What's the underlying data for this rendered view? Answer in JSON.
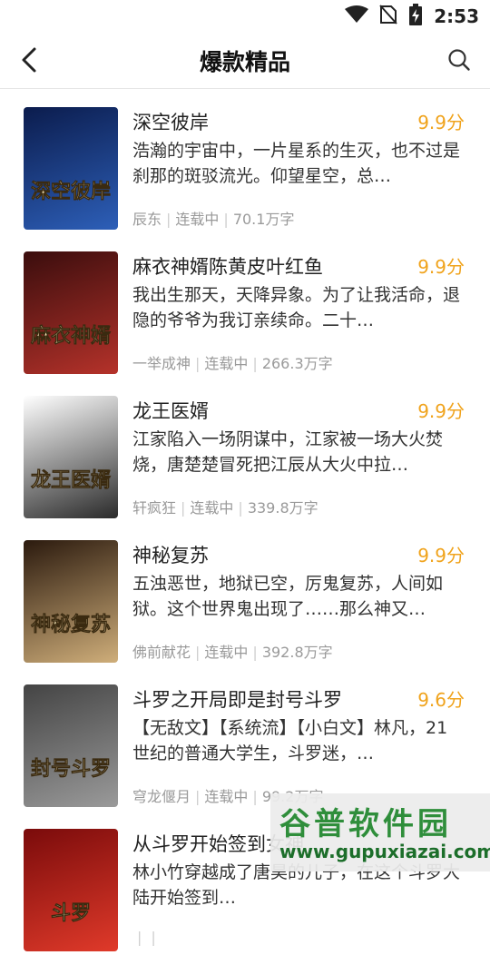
{
  "status_bar": {
    "time": "2:53"
  },
  "header": {
    "title": "爆款精品"
  },
  "books": [
    {
      "title": "深空彼岸",
      "score": "9.9分",
      "desc": "浩瀚的宇宙中，一片星系的生灭，也不过是刹那的斑驳流光。仰望星空，总…",
      "author": "辰东",
      "status": "连载中",
      "words": "70.1万字",
      "cover_text": "深空彼岸",
      "cover_colors": [
        "#0b1c4d",
        "#2d5fb8"
      ]
    },
    {
      "title": "麻衣神婿陈黄皮叶红鱼",
      "score": "9.9分",
      "desc": "我出生那天，天降异象。为了让我活命，退隐的爷爷为我订亲续命。二十…",
      "author": "一举成神",
      "status": "连载中",
      "words": "266.3万字",
      "cover_text": "麻衣神婿",
      "cover_colors": [
        "#3a0d0d",
        "#b5322a"
      ]
    },
    {
      "title": "龙王医婿",
      "score": "9.9分",
      "desc": "江家陷入一场阴谋中，江家被一场大火焚烧，唐楚楚冒死把江辰从大火中拉…",
      "author": "轩疯狂",
      "status": "连载中",
      "words": "339.8万字",
      "cover_text": "龙王医婿",
      "cover_colors": [
        "#ffffff",
        "#2a2a2a"
      ]
    },
    {
      "title": "神秘复苏",
      "score": "9.9分",
      "desc": "五浊恶世，地狱已空，厉鬼复苏，人间如狱。这个世界鬼出现了……那么神又…",
      "author": "佛前献花",
      "status": "连载中",
      "words": "392.8万字",
      "cover_text": "神秘复苏",
      "cover_colors": [
        "#2b1a0e",
        "#cfae7a"
      ]
    },
    {
      "title": "斗罗之开局即是封号斗罗",
      "score": "9.6分",
      "desc": "【无敌文】【系统流】【小白文】林凡，21世纪的普通大学生，斗罗迷，…",
      "author": "穹龙偃月",
      "status": "连载中",
      "words": "99.2万字",
      "cover_text": "封号斗罗",
      "cover_colors": [
        "#444444",
        "#9a9a9a"
      ]
    },
    {
      "title": "从斗罗开始签到女神",
      "score": "",
      "desc": "林小竹穿越成了唐昊的儿子，在这个斗罗大陆开始签到…",
      "author": "",
      "status": "",
      "words": "",
      "cover_text": "斗罗",
      "cover_colors": [
        "#7a0b0b",
        "#e03a2a"
      ]
    }
  ],
  "watermark": {
    "text": "谷普软件园",
    "url": "www.gupuxiazai.com"
  }
}
